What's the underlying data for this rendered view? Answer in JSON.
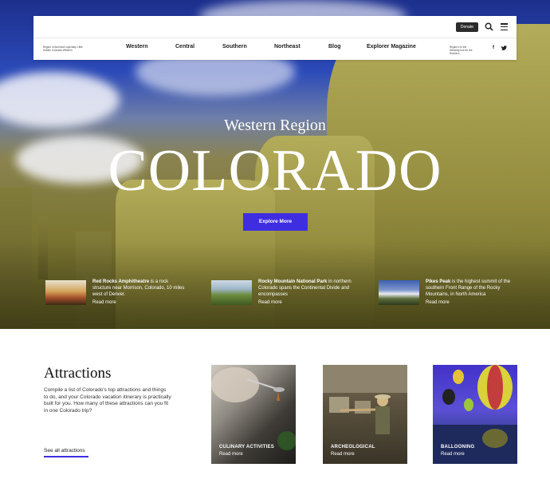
{
  "nav": {
    "brand_text": "Region of America's specialty. Little Hidden Colorado Western",
    "donate_label": "Donate",
    "links": [
      "Western",
      "Central",
      "Southern",
      "Northeast",
      "Blog",
      "Explorer Magazine"
    ],
    "right_text": "Region's to the following hub for the Northern"
  },
  "hero": {
    "subtitle": "Western Region",
    "title": "COLORADO",
    "cta_label": "Explore More"
  },
  "features": [
    {
      "name": "Red Rocks Amphitheatre",
      "desc": " is a rock structure near Morrison, Colorado, 10 miles west of Denver.",
      "more": "Read more"
    },
    {
      "name": "Rocky Mountain National Park",
      "desc": " in northern Colorado spans the Continental Divide and encompasses",
      "more": "Read more"
    },
    {
      "name": "Pikes Peak",
      "desc": " is the highest summit of the southern Front Range of the Rocky Mountains, in North America",
      "more": "Read more"
    }
  ],
  "attractions": {
    "title": "Attractions",
    "description": "Compile a list of Colorado's top attractions and things to do, and your Colorado vacation itinerary is practically built for you. How many of these attractions can you fit in one Colorado trip?",
    "see_all_label": "See all attractions",
    "cards": [
      {
        "label": "CULINARY ACTIVITIES",
        "more": "Read more"
      },
      {
        "label": "ARCHEOLOGICAL",
        "more": "Read more"
      },
      {
        "label": "BALLOONING",
        "more": "Read more"
      }
    ]
  },
  "colors": {
    "accent": "#3f2ee0",
    "dark": "#2b2b2b"
  }
}
